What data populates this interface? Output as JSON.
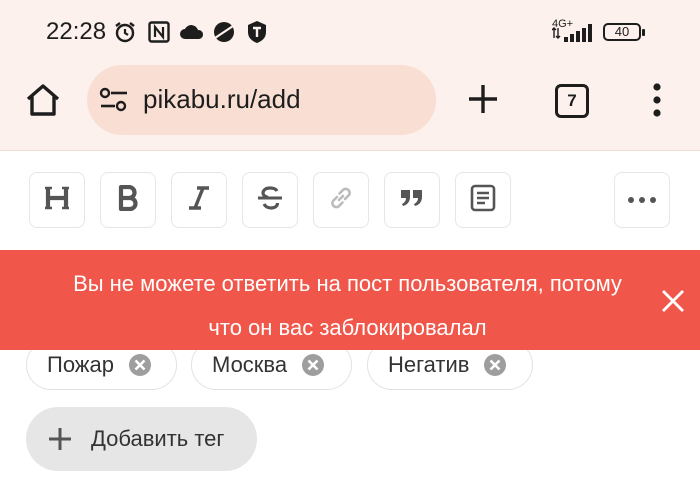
{
  "status_bar": {
    "time": "22:28",
    "network": "4G+",
    "battery": "40",
    "icons": [
      "alarm-icon",
      "nfc-icon",
      "cloud-icon",
      "planet-icon",
      "vpn-icon",
      "signal-icon"
    ]
  },
  "browser": {
    "url": "pikabu.ru/add",
    "tab_count": "7",
    "icons": [
      "home-icon",
      "site-settings-icon",
      "plus-icon",
      "more-vert-icon"
    ]
  },
  "editor_toolbar": {
    "buttons": [
      {
        "name": "heading",
        "glyph": "H"
      },
      {
        "name": "bold",
        "glyph": "B"
      },
      {
        "name": "italic",
        "glyph": "I"
      },
      {
        "name": "strikethrough",
        "glyph": "S"
      },
      {
        "name": "link",
        "glyph": "link"
      },
      {
        "name": "quote",
        "glyph": "quote"
      },
      {
        "name": "note",
        "glyph": "note"
      },
      {
        "name": "more",
        "glyph": "more"
      }
    ]
  },
  "toast": {
    "line1": "Вы не можете ответить на пост пользователя, потому",
    "line2": "что он вас заблокировалал",
    "color": "#f0574a"
  },
  "tags": {
    "items": [
      "Пожар",
      "Москва",
      "Негатив"
    ],
    "add_label": "Добавить тег"
  }
}
